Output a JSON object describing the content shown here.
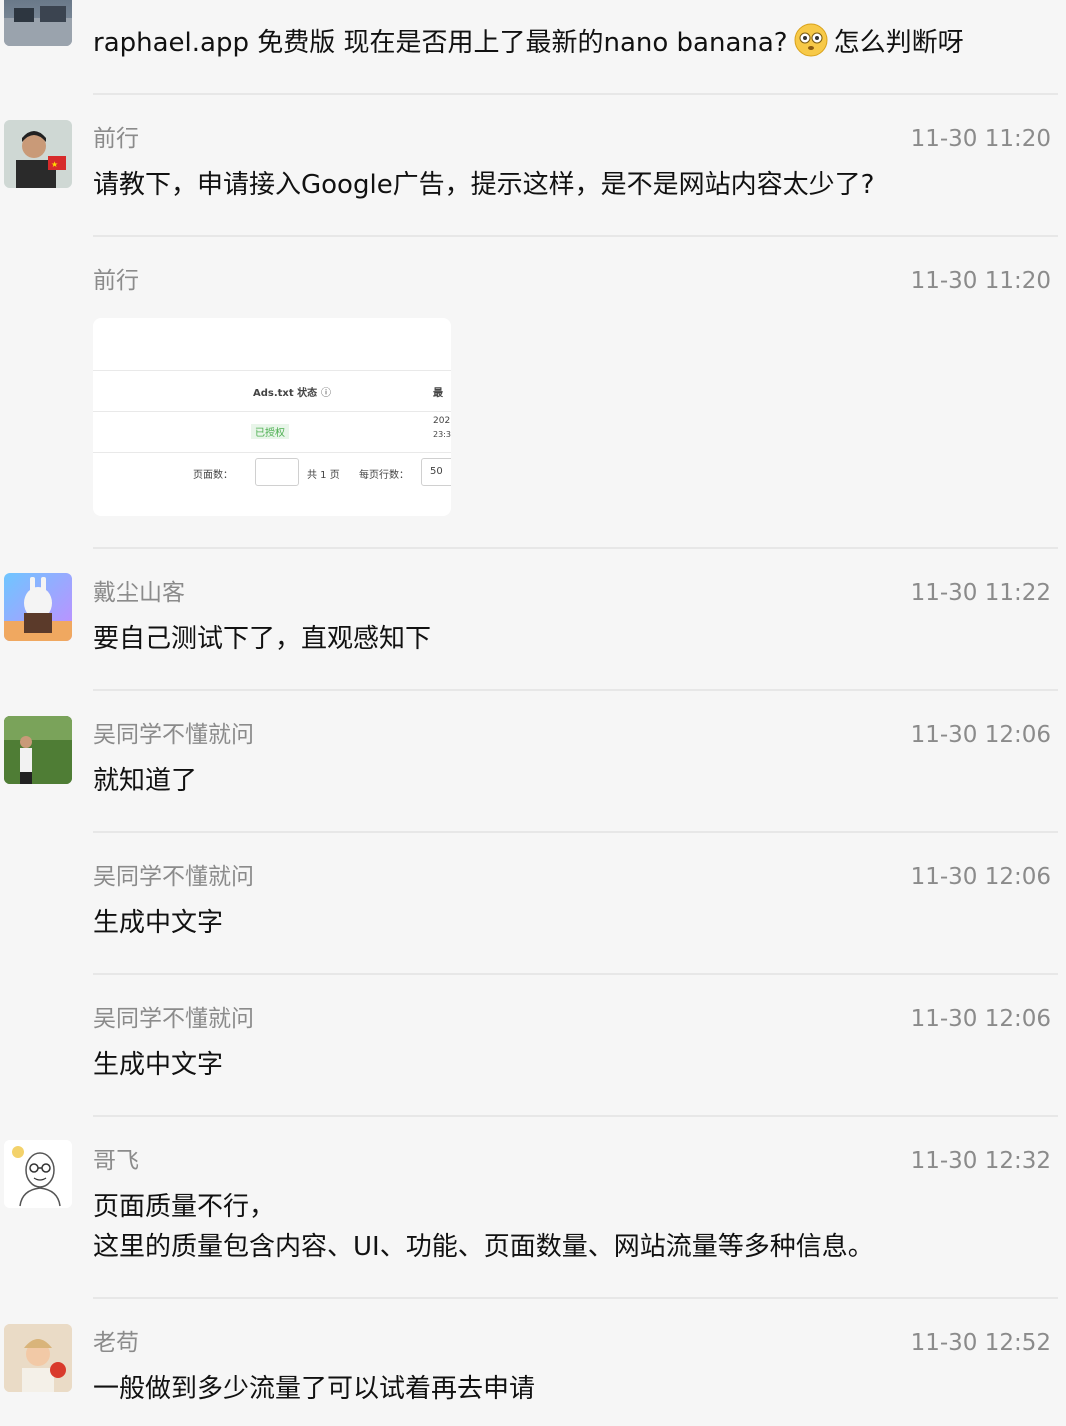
{
  "messages": [
    {
      "sender": "",
      "time": "",
      "lines": [
        "raphael.app 免费版 现在是否用上了最新的nano banana?",
        "怎么判断呀"
      ],
      "emoji": "flushed-face"
    },
    {
      "sender": "前行",
      "time": "11-30 11:20",
      "lines": [
        "请教下，申请接入Google广告，提示这样，是不是网站内容太少了?"
      ]
    },
    {
      "sender": "前行",
      "time": "11-30 11:20",
      "image": {
        "header": "Ads.txt 状态",
        "header2": "最",
        "status": "已授权",
        "date1": "202",
        "date2": "23:3",
        "pager_label": "页面数：",
        "pager_total": "共 1 页",
        "pager_rows": "每页行数：",
        "pager_rows_value": "50"
      }
    },
    {
      "sender": "戴尘山客",
      "time": "11-30 11:22",
      "lines": [
        "要自己测试下了，直观感知下"
      ]
    },
    {
      "sender": "吴同学不懂就问",
      "time": "11-30 12:06",
      "lines": [
        "就知道了"
      ]
    },
    {
      "sender": "吴同学不懂就问",
      "time": "11-30 12:06",
      "lines": [
        "生成中文字"
      ]
    },
    {
      "sender": "吴同学不懂就问",
      "time": "11-30 12:06",
      "lines": [
        "生成中文字"
      ]
    },
    {
      "sender": "哥飞",
      "time": "11-30 12:32",
      "lines": [
        "页面质量不行，",
        "这里的质量包含内容、UI、功能、页面数量、网站流量等多种信息。"
      ]
    },
    {
      "sender": "老苟",
      "time": "11-30 12:52",
      "lines": [
        "一般做到多少流量了可以试着再去申请"
      ]
    }
  ],
  "colors": {
    "background": "#f6f6f6",
    "meta_text": "#8b8b8b",
    "body_text": "#111111",
    "separator": "#e7e7e7",
    "status_green": "#4caf50"
  }
}
